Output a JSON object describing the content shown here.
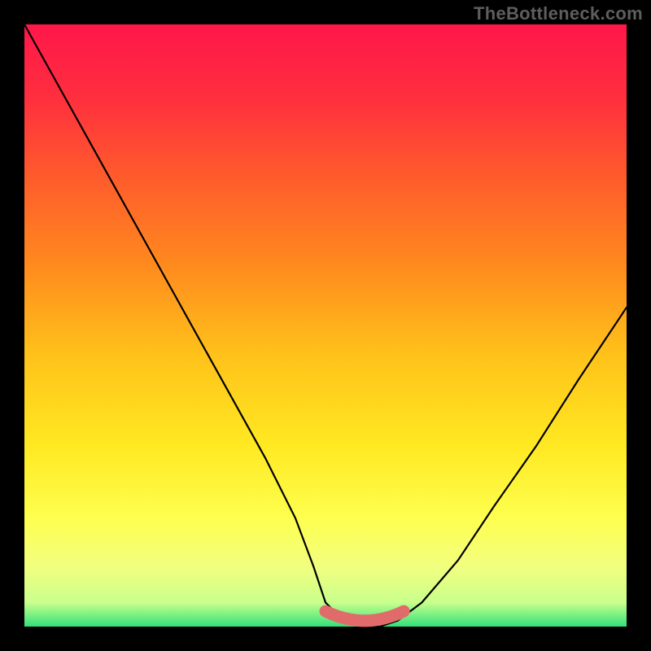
{
  "watermark": "TheBottleneck.com",
  "colors": {
    "black": "#000000",
    "curve": "#000000",
    "salmon": "#E16B6B",
    "gradient_stops": [
      {
        "offset": 0.0,
        "color": "#FF174A"
      },
      {
        "offset": 0.12,
        "color": "#FF2E3F"
      },
      {
        "offset": 0.25,
        "color": "#FF5A2C"
      },
      {
        "offset": 0.4,
        "color": "#FF8A1E"
      },
      {
        "offset": 0.55,
        "color": "#FFC21A"
      },
      {
        "offset": 0.7,
        "color": "#FFE922"
      },
      {
        "offset": 0.82,
        "color": "#FEFF4F"
      },
      {
        "offset": 0.9,
        "color": "#F2FF7F"
      },
      {
        "offset": 0.95,
        "color": "#C9FF8C"
      },
      {
        "offset": 1.0,
        "color": "#32E27B"
      }
    ]
  },
  "chart_data": {
    "type": "line",
    "title": "",
    "xlabel": "",
    "ylabel": "",
    "xlim": [
      0,
      100
    ],
    "ylim": [
      0,
      100
    ],
    "series": [
      {
        "name": "bottleneck-curve",
        "x": [
          0,
          5,
          10,
          15,
          20,
          25,
          30,
          35,
          40,
          45,
          48,
          50,
          53,
          56,
          59,
          62,
          66,
          72,
          78,
          85,
          92,
          100
        ],
        "y": [
          100,
          91,
          82,
          73,
          64,
          55,
          46,
          37,
          28,
          18,
          10,
          4,
          1,
          0,
          0,
          1,
          4,
          11,
          20,
          30,
          41,
          53
        ]
      }
    ],
    "annotation": {
      "name": "optimal-band",
      "x_range": [
        50,
        63
      ],
      "y": 0
    }
  }
}
